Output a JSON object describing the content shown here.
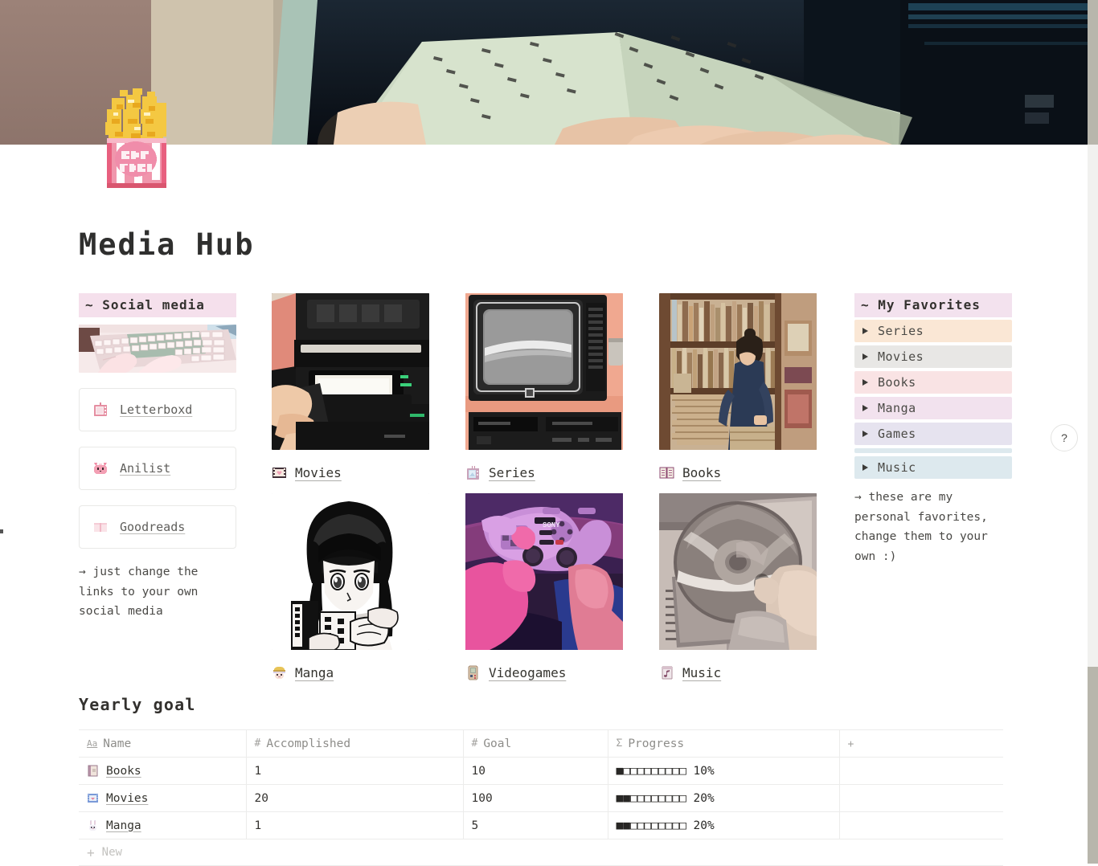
{
  "page": {
    "title": "Media Hub",
    "icon": "popcorn-icon",
    "banner": "anime-hands-holding-open-book-banner"
  },
  "social_column": {
    "heading": "~ Social media",
    "thumbnail": "pastel-keyboard-illustration",
    "links": [
      {
        "label": "Letterboxd",
        "icon": "retro-tv-pink-icon"
      },
      {
        "label": "Anilist",
        "icon": "pink-cat-face-icon"
      },
      {
        "label": "Goodreads",
        "icon": "open-book-pink-icon"
      }
    ],
    "note": "→ just change the links to your own social media"
  },
  "media_cards": [
    {
      "label": "Movies",
      "icon": "film-strip-heart-icon",
      "image": "hand-inserting-vhs-tape-into-vcr"
    },
    {
      "label": "Series",
      "icon": "crt-television-icon",
      "image": "retro-crt-tv-on-stand"
    },
    {
      "label": "Books",
      "icon": "open-book-icon",
      "image": "person-browsing-bookstore-shelves"
    },
    {
      "label": "Manga",
      "icon": "manga-character-face-icon",
      "image": "monochrome-anime-girl-reading-magazine"
    },
    {
      "label": "Videogames",
      "icon": "handheld-console-icon",
      "image": "hands-holding-pink-playstation-controller"
    },
    {
      "label": "Music",
      "icon": "music-note-card-icon",
      "image": "hand-holding-cd-disc"
    }
  ],
  "favorites_column": {
    "heading": "~ My Favorites",
    "items": [
      {
        "label": "Series",
        "color": "#fae7d5"
      },
      {
        "label": "Movies",
        "color": "#e8e7e5"
      },
      {
        "label": "Books",
        "color": "#f9e3e4"
      },
      {
        "label": "Manga",
        "color": "#f2e2ee"
      },
      {
        "label": "Games",
        "color": "#e6e3ef"
      },
      {
        "label": "Music",
        "color": "#dde9ee"
      }
    ],
    "note": "→ these are my personal favorites, change them to your own :)"
  },
  "yearly_goal": {
    "title": "Yearly goal",
    "columns": [
      {
        "label": "Name",
        "type_icon": "Aa"
      },
      {
        "label": "Accomplished",
        "type_icon": "#"
      },
      {
        "label": "Goal",
        "type_icon": "#"
      },
      {
        "label": "Progress",
        "type_icon": "Σ"
      },
      {
        "label": "",
        "type_icon": "+"
      }
    ],
    "rows": [
      {
        "name": "Books",
        "icon": "closed-book-icon",
        "accomplished": "1",
        "goal": "10",
        "progress_bar": "■□□□□□□□□□",
        "progress_pct": "10%"
      },
      {
        "name": "Movies",
        "icon": "film-frame-heart-icon",
        "accomplished": "20",
        "goal": "100",
        "progress_bar": "■■□□□□□□□□",
        "progress_pct": "20%"
      },
      {
        "name": "Manga",
        "icon": "bunny-face-icon",
        "accomplished": "1",
        "goal": "5",
        "progress_bar": "■■□□□□□□□□",
        "progress_pct": "20%"
      }
    ],
    "new_row_label": "New"
  },
  "chrome": {
    "help_label": "?",
    "accent_pink": "#f5e0ec"
  }
}
